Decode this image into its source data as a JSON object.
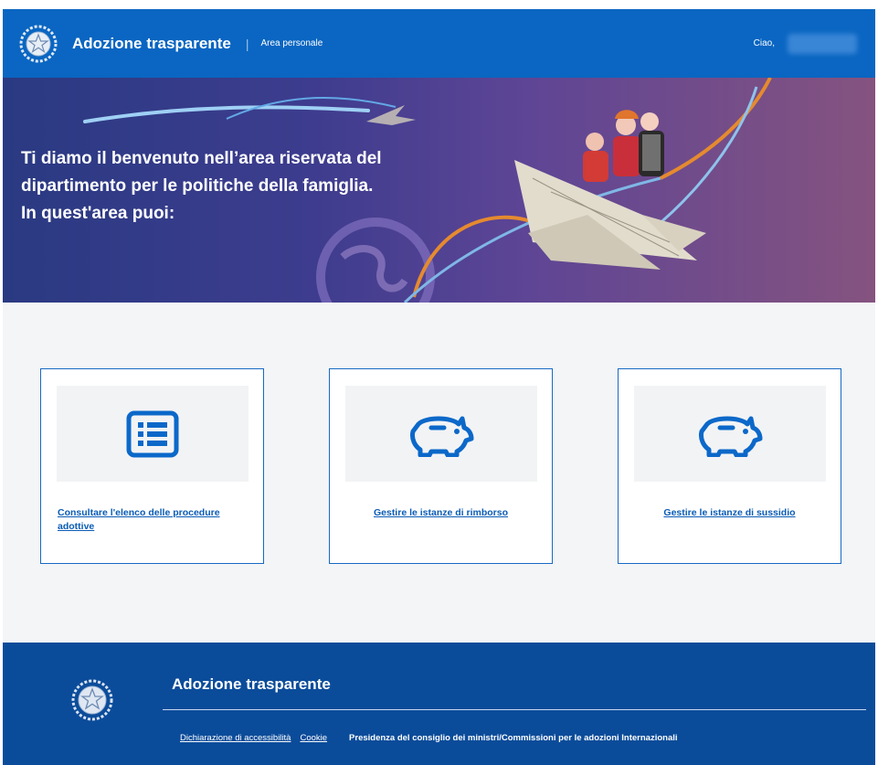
{
  "header": {
    "brand": "Adozione trasparente",
    "area": "Area personale",
    "greeting": "Ciao,"
  },
  "hero": {
    "line1": "Ti diamo il benvenuto nell’area riservata del",
    "line2": "dipartimento per le politiche della famiglia.",
    "line3": "In quest'area puoi:"
  },
  "cards": [
    {
      "label": "Consultare l'elenco delle procedure adottive",
      "icon": "list-icon"
    },
    {
      "label": "Gestire le istanze di rimborso",
      "icon": "piggy-bank-icon"
    },
    {
      "label": "Gestire le istanze di sussidio",
      "icon": "piggy-bank-icon"
    }
  ],
  "footer": {
    "title": "Adozione trasparente",
    "accessibility": "Dichiarazione di accessibilità",
    "cookie": "Cookie",
    "org": "Presidenza del consiglio dei ministri/Commissioni per le adozioni Internazionali"
  },
  "colors": {
    "header": "#0a66c2",
    "accent": "#1769c4",
    "footer": "#0b4c9a"
  }
}
